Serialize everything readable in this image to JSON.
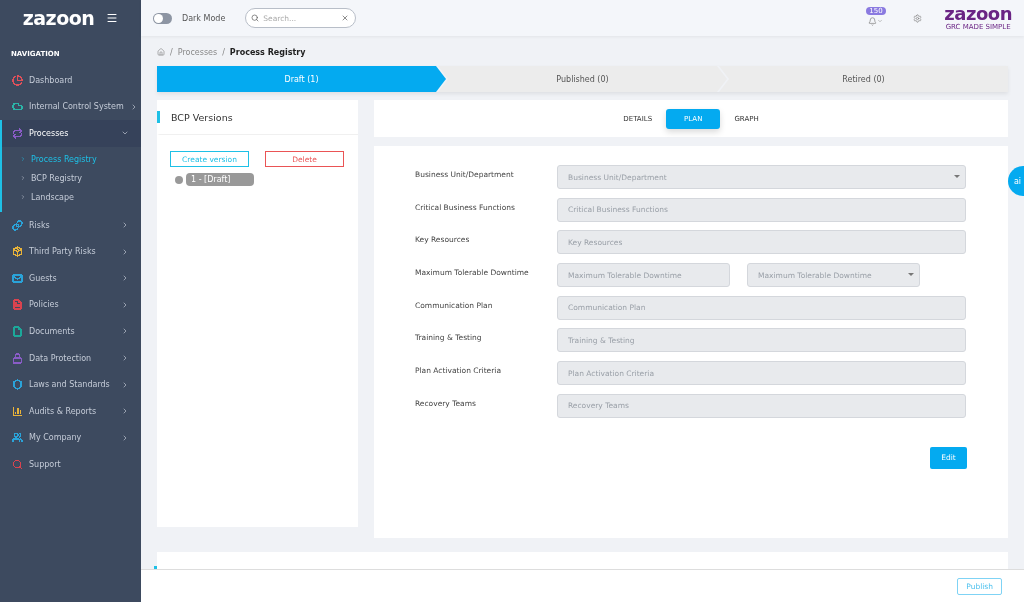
{
  "sidebar": {
    "logo": "zazoon",
    "section_title": "NAVIGATION",
    "items": [
      {
        "label": "Dashboard",
        "kind": "dashboard",
        "color": "#e0505a",
        "expandable": false,
        "expanded": false,
        "selected": false
      },
      {
        "label": "Internal Control System",
        "kind": "umbrella",
        "color": "#2bb5a8",
        "expandable": true,
        "expanded": false,
        "selected": false
      },
      {
        "label": "Processes",
        "kind": "processes",
        "color": "#8a5cc7",
        "expandable": true,
        "expanded": true,
        "selected": true,
        "children": [
          {
            "label": "Process Registry",
            "selected": true
          },
          {
            "label": "BCP Registry",
            "selected": false
          },
          {
            "label": "Landscape",
            "selected": false
          }
        ]
      },
      {
        "label": "Risks",
        "kind": "link",
        "color": "#2aa3d9",
        "expandable": true,
        "expanded": false,
        "selected": false
      },
      {
        "label": "Third Party Risks",
        "kind": "package",
        "color": "#e8b339",
        "expandable": true,
        "expanded": false,
        "selected": false
      },
      {
        "label": "Guests",
        "kind": "mail",
        "color": "#2aa3d9",
        "expandable": true,
        "expanded": false,
        "selected": false
      },
      {
        "label": "Policies",
        "kind": "policy",
        "color": "#d9434f",
        "expandable": true,
        "expanded": false,
        "selected": false
      },
      {
        "label": "Documents",
        "kind": "document",
        "color": "#1ca89a",
        "expandable": true,
        "expanded": false,
        "selected": false
      },
      {
        "label": "Data Protection",
        "kind": "lock",
        "color": "#8a5cc7",
        "expandable": true,
        "expanded": false,
        "selected": false
      },
      {
        "label": "Laws and Standards",
        "kind": "shield",
        "color": "#2aa3d9",
        "expandable": true,
        "expanded": false,
        "selected": false
      },
      {
        "label": "Audits & Reports",
        "kind": "chart",
        "color": "#e8b339",
        "expandable": true,
        "expanded": false,
        "selected": false
      },
      {
        "label": "My Company",
        "kind": "users",
        "color": "#2aa3d9",
        "expandable": true,
        "expanded": false,
        "selected": false
      },
      {
        "label": "Support",
        "kind": "search",
        "color": "#d9434f",
        "expandable": false,
        "expanded": false,
        "selected": false
      }
    ]
  },
  "topbar": {
    "dark_mode": {
      "label": "Dark Mode",
      "on": false
    },
    "search": {
      "placeholder": "Search..."
    },
    "notifications": {
      "count": "150"
    },
    "brand": {
      "name": "zazoon",
      "tagline": "GRC MADE SIMPLE"
    }
  },
  "breadcrumb": {
    "separator": "/",
    "items": [
      "Processes",
      "Process Registry"
    ]
  },
  "steps": [
    {
      "label": "Draft (1)",
      "selected": true
    },
    {
      "label": "Published (0)",
      "selected": false
    },
    {
      "label": "Retired (0)",
      "selected": false
    }
  ],
  "versions": {
    "title": "BCP Versions",
    "buttons": [
      "Create version",
      "Delete"
    ],
    "items": [
      {
        "label": "1 - [Draft]",
        "selected": true
      }
    ]
  },
  "tabs": [
    {
      "label": "DETAILS",
      "selected": false
    },
    {
      "label": "PLAN",
      "selected": true
    },
    {
      "label": "GRAPH",
      "selected": false
    }
  ],
  "form": {
    "rows": [
      {
        "label": "Business Unit/Department",
        "inputs": [
          {
            "kind": "select",
            "placeholder": "Business Unit/Department"
          }
        ]
      },
      {
        "label": "Critical Business Functions",
        "inputs": [
          {
            "kind": "text",
            "placeholder": "Critical Business Functions"
          }
        ]
      },
      {
        "label": "Key Resources",
        "inputs": [
          {
            "kind": "text",
            "placeholder": "Key Resources"
          }
        ]
      },
      {
        "label": "Maximum Tolerable Downtime",
        "inputs": [
          {
            "kind": "text",
            "placeholder": "Maximum Tolerable Downtime"
          },
          {
            "kind": "select",
            "placeholder": "Maximum Tolerable Downtime"
          }
        ]
      },
      {
        "label": "Communication Plan",
        "inputs": [
          {
            "kind": "text",
            "placeholder": "Communication Plan"
          }
        ]
      },
      {
        "label": "Training & Testing",
        "inputs": [
          {
            "kind": "text",
            "placeholder": "Training & Testing"
          }
        ]
      },
      {
        "label": "Plan Activation Criteria",
        "inputs": [
          {
            "kind": "text",
            "placeholder": "Plan Activation Criteria"
          }
        ]
      },
      {
        "label": "Recovery Teams",
        "inputs": [
          {
            "kind": "text",
            "placeholder": "Recovery Teams"
          }
        ]
      }
    ],
    "edit_button": "Edit"
  },
  "ai_tab": "ai",
  "footer": {
    "publish_button": "Publish"
  }
}
